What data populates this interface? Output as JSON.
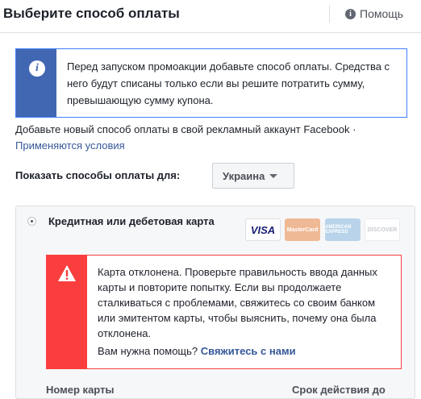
{
  "header": {
    "title": "Выберите способ оплаты",
    "help_label": "Помощь",
    "help_icon": "info-icon"
  },
  "info_notice": {
    "icon": "info-icon",
    "text": "Перед запуском промоакции добавьте способ оплаты. Средства с него будут списаны только если вы решите потратить сумму, превышающую сумму купона.",
    "accent_color": "#4267b2"
  },
  "add_method_text": "Добавьте новый способ оплаты в свой рекламный аккаунт Facebook ·",
  "terms_link": "Применяются условия",
  "country_filter": {
    "label": "Показать способы оплаты для:",
    "selected": "Украина"
  },
  "payment_options": [
    {
      "label": "Кредитная или дебетовая карта",
      "selected": true,
      "logos": [
        {
          "name": "visa-logo",
          "text": "VISA"
        },
        {
          "name": "mastercard-logo",
          "text": "MasterCard"
        },
        {
          "name": "amex-logo",
          "text": "AMERICAN EXPRESS"
        },
        {
          "name": "discover-logo",
          "text": "DISCOVER"
        }
      ]
    }
  ],
  "error_notice": {
    "icon": "warning-icon",
    "text": "Карта отклонена. Проверьте правильность ввода данных карты и повторите попытку. Если вы продолжаете сталкиваться с проблемами, свяжитесь со своим банком или эмитентом карты, чтобы выяснить, почему она была отклонена.",
    "help_question": "Вам нужна помощь?",
    "contact_link": "Свяжитесь с нами",
    "accent_color": "#fa3e3e"
  },
  "card_form": {
    "card_number_label": "Номер карты",
    "expiry_label": "Срок действия до"
  }
}
